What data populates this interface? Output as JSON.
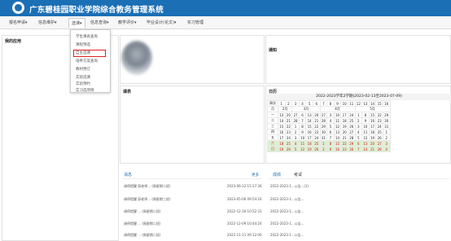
{
  "header": {
    "title": "广东碧桂园职业学院综合教务管理系统",
    "brand_color": "#1b6fb5",
    "logo": "school-logo-icon"
  },
  "nav": {
    "items": [
      {
        "label": "报名申请▾"
      },
      {
        "label": "信息维护▾"
      },
      {
        "label": "选课▾"
      },
      {
        "label": "信息查询▾"
      },
      {
        "label": "教学评价▾"
      },
      {
        "label": "毕业设计(论文)▾"
      },
      {
        "label": "实习管理"
      }
    ]
  },
  "dropdown": {
    "items": [
      {
        "label": "学生课表查询"
      },
      {
        "label": "课程预选"
      },
      {
        "label": "自主选课"
      },
      {
        "label": "培养方案查询"
      },
      {
        "label": "教材预订"
      },
      {
        "label": "实验选课"
      },
      {
        "label": "实验预约"
      },
      {
        "label": "实习选项目"
      }
    ]
  },
  "panels": {
    "my_apps": "我的应用",
    "notice": "通知",
    "classroom": "课表",
    "calendar": "日历",
    "messages": "消息",
    "more": "更多"
  },
  "calendar": {
    "banner": "2022-2023学年2学期(2023-02-13至2023-07-09)",
    "col_label": "周次",
    "weeks": [
      "1",
      "2",
      "3",
      "4",
      "5",
      "6",
      "7",
      "8",
      "9",
      "10",
      "11",
      "12",
      "13",
      "14",
      "15",
      "16"
    ],
    "month_label": "月",
    "months": [
      "2月",
      "3月",
      "4月",
      "5月"
    ],
    "days": [
      {
        "label": "一",
        "dates": [
          "13",
          "20",
          "27",
          "6",
          "13",
          "20",
          "27",
          "3",
          "10",
          "17",
          "24",
          "1",
          "8",
          "15",
          "22",
          "29"
        ]
      },
      {
        "label": "二",
        "dates": [
          "14",
          "21",
          "28",
          "7",
          "14",
          "21",
          "28",
          "4",
          "11",
          "18",
          "25",
          "2",
          "9",
          "16",
          "23",
          "30"
        ]
      },
      {
        "label": "三",
        "dates": [
          "15",
          "22",
          "1",
          "8",
          "15",
          "22",
          "29",
          "5",
          "12",
          "19",
          "26",
          "3",
          "10",
          "17",
          "24",
          "31"
        ]
      },
      {
        "label": "四",
        "dates": [
          "16",
          "23",
          "2",
          "9",
          "16",
          "23",
          "30",
          "6",
          "13",
          "20",
          "27",
          "4",
          "11",
          "18",
          "25",
          "1"
        ]
      },
      {
        "label": "五",
        "dates": [
          "17",
          "24",
          "3",
          "10",
          "17",
          "24",
          "31",
          "7",
          "14",
          "21",
          "28",
          "5",
          "12",
          "19",
          "26",
          "2"
        ]
      },
      {
        "label": "六",
        "dates": [
          "18",
          "25",
          "4",
          "11",
          "18",
          "25",
          "1",
          "8",
          "15",
          "22",
          "29",
          "6",
          "13",
          "20",
          "27",
          "3"
        ]
      },
      {
        "label": "日",
        "dates": [
          "19",
          "26",
          "5",
          "12",
          "19",
          "26",
          "2",
          "9",
          "16",
          "23",
          "30",
          "7",
          "14",
          "21",
          "28",
          "4"
        ]
      }
    ]
  },
  "messages": [
    {
      "title": "调停提醒 邱老师... (周星期二班)",
      "time": "2023-06-12 15:17:36"
    },
    {
      "title": "调停提醒 邱老师... (周星期三班)",
      "time": "2023-05-06 09:54:16"
    },
    {
      "title": "调停提醒 ... (周星期二班)",
      "time": "2022-12-16 10:52:31"
    },
    {
      "title": "调停提醒 ... (周星期二班)",
      "time": "2022-12-09 16:44:24"
    },
    {
      "title": "调停提醒 ... (周星期二班)",
      "time": "2022-11-11 09:12:00"
    }
  ],
  "right_tabs": [
    "成绩",
    "考试"
  ],
  "right_list": [
    "2022-2023-1...公告...(1)",
    "2022-2023-1...公告...",
    "2022-2023-1...公告...",
    "2022-2023-1...公告...",
    "2022-2023-1...公告..."
  ]
}
